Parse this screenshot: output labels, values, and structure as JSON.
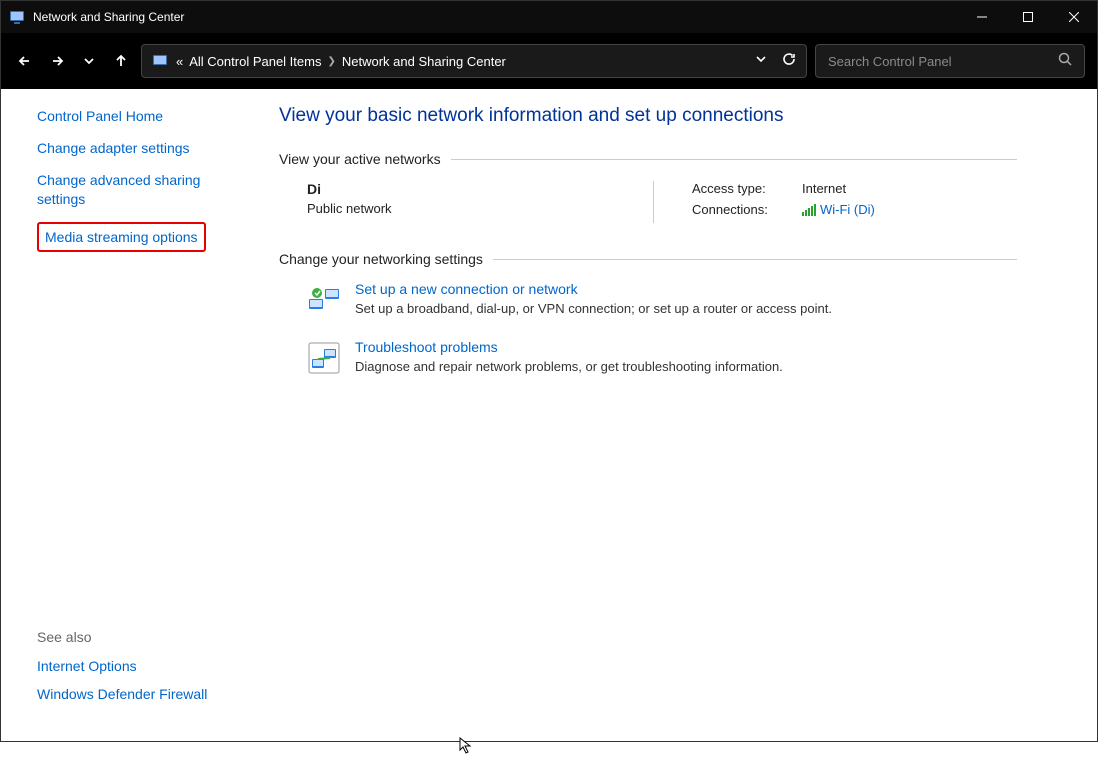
{
  "window": {
    "title": "Network and Sharing Center"
  },
  "toolbar": {
    "breadcrumb_prefix": "«",
    "crumbs": [
      "All Control Panel Items",
      "Network and Sharing Center"
    ],
    "search_placeholder": "Search Control Panel"
  },
  "sidebar": {
    "links": [
      "Control Panel Home",
      "Change adapter settings",
      "Change advanced sharing settings",
      "Media streaming options"
    ],
    "see_also": {
      "heading": "See also",
      "links": [
        "Internet Options",
        "Windows Defender Firewall"
      ]
    }
  },
  "main": {
    "title": "View your basic network information and set up connections",
    "active_networks_heading": "View your active networks",
    "network": {
      "name": "Di",
      "category": "Public network",
      "access_type_label": "Access type:",
      "access_type_value": "Internet",
      "connections_label": "Connections:",
      "connection_link": "Wi-Fi (Di)"
    },
    "change_settings_heading": "Change your networking settings",
    "items": [
      {
        "title": "Set up a new connection or network",
        "desc": "Set up a broadband, dial-up, or VPN connection; or set up a router or access point."
      },
      {
        "title": "Troubleshoot problems",
        "desc": "Diagnose and repair network problems, or get troubleshooting information."
      }
    ]
  }
}
